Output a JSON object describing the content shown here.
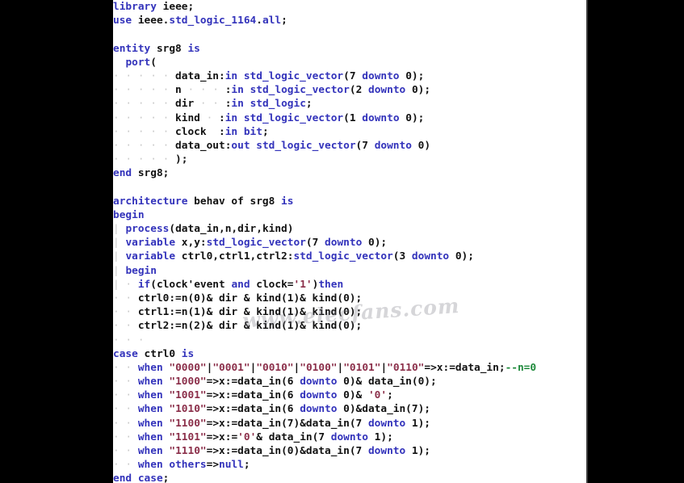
{
  "editor": {
    "background_color": "#ffffff",
    "letterbox_color": "#000000",
    "language": "VHDL",
    "font_style": "monospace-bold",
    "colors": {
      "keyword": "#3333bb",
      "identifier": "#111111",
      "string": "#8b2f4a",
      "comment": "#1f8a3c",
      "indent_guide": "#c9c9c9"
    }
  },
  "watermark": {
    "text": "www.elecfans.com"
  },
  "code": {
    "lines": [
      {
        "n": 1,
        "tokens": [
          {
            "t": "library",
            "c": "kw"
          },
          {
            "t": " ",
            "c": "pun"
          },
          {
            "t": "ieee",
            "c": "id"
          },
          {
            "t": ";",
            "c": "pun"
          }
        ]
      },
      {
        "n": 2,
        "tokens": [
          {
            "t": "use",
            "c": "kw"
          },
          {
            "t": " ",
            "c": "pun"
          },
          {
            "t": "ieee",
            "c": "id"
          },
          {
            "t": ".",
            "c": "pun"
          },
          {
            "t": "std_logic_1164",
            "c": "kw"
          },
          {
            "t": ".",
            "c": "pun"
          },
          {
            "t": "all",
            "c": "kw"
          },
          {
            "t": ";",
            "c": "pun"
          }
        ]
      },
      {
        "n": 3,
        "tokens": []
      },
      {
        "n": 4,
        "tokens": [
          {
            "t": "entity",
            "c": "kw"
          },
          {
            "t": " srg8 ",
            "c": "id"
          },
          {
            "t": "is",
            "c": "kw"
          }
        ]
      },
      {
        "n": 5,
        "tokens": [
          {
            "t": " ",
            "c": "dots"
          },
          {
            "t": " ",
            "c": "pun"
          },
          {
            "t": "port",
            "c": "kw"
          },
          {
            "t": "(",
            "c": "pun"
          }
        ]
      },
      {
        "n": 6,
        "tokens": [
          {
            "t": "· · · · ·",
            "c": "dots"
          },
          {
            "t": " data_in",
            "c": "id"
          },
          {
            "t": ":",
            "c": "pun"
          },
          {
            "t": "in",
            "c": "kw"
          },
          {
            "t": " ",
            "c": "pun"
          },
          {
            "t": "std_logic_vector",
            "c": "kw"
          },
          {
            "t": "(",
            "c": "pun"
          },
          {
            "t": "7",
            "c": "id"
          },
          {
            "t": " ",
            "c": "pun"
          },
          {
            "t": "downto",
            "c": "kw"
          },
          {
            "t": " 0);",
            "c": "id"
          }
        ]
      },
      {
        "n": 7,
        "tokens": [
          {
            "t": "· · · · ·",
            "c": "dots"
          },
          {
            "t": " n",
            "c": "id"
          },
          {
            "t": " · · ·",
            "c": "dots"
          },
          {
            "t": " :",
            "c": "pun"
          },
          {
            "t": "in",
            "c": "kw"
          },
          {
            "t": " ",
            "c": "pun"
          },
          {
            "t": "std_logic_vector",
            "c": "kw"
          },
          {
            "t": "(",
            "c": "pun"
          },
          {
            "t": "2",
            "c": "id"
          },
          {
            "t": " ",
            "c": "pun"
          },
          {
            "t": "downto",
            "c": "kw"
          },
          {
            "t": " 0);",
            "c": "id"
          }
        ]
      },
      {
        "n": 8,
        "tokens": [
          {
            "t": "· · · · ·",
            "c": "dots"
          },
          {
            "t": " dir",
            "c": "id"
          },
          {
            "t": " · ·",
            "c": "dots"
          },
          {
            "t": " :",
            "c": "pun"
          },
          {
            "t": "in",
            "c": "kw"
          },
          {
            "t": " ",
            "c": "pun"
          },
          {
            "t": "std_logic",
            "c": "kw"
          },
          {
            "t": ";",
            "c": "pun"
          }
        ]
      },
      {
        "n": 9,
        "tokens": [
          {
            "t": "· · · · ·",
            "c": "dots"
          },
          {
            "t": " kind",
            "c": "id"
          },
          {
            "t": " ·",
            "c": "dots"
          },
          {
            "t": " :",
            "c": "pun"
          },
          {
            "t": "in",
            "c": "kw"
          },
          {
            "t": " ",
            "c": "pun"
          },
          {
            "t": "std_logic_vector",
            "c": "kw"
          },
          {
            "t": "(",
            "c": "pun"
          },
          {
            "t": "1",
            "c": "id"
          },
          {
            "t": " ",
            "c": "pun"
          },
          {
            "t": "downto",
            "c": "kw"
          },
          {
            "t": " 0);",
            "c": "id"
          }
        ]
      },
      {
        "n": 10,
        "tokens": [
          {
            "t": "· · · · ·",
            "c": "dots"
          },
          {
            "t": " clock",
            "c": "id"
          },
          {
            "t": "  :",
            "c": "pun"
          },
          {
            "t": "in",
            "c": "kw"
          },
          {
            "t": " ",
            "c": "pun"
          },
          {
            "t": "bit",
            "c": "kw"
          },
          {
            "t": ";",
            "c": "pun"
          }
        ]
      },
      {
        "n": 11,
        "tokens": [
          {
            "t": "· · · · ·",
            "c": "dots"
          },
          {
            "t": " data_out",
            "c": "id"
          },
          {
            "t": ":",
            "c": "pun"
          },
          {
            "t": "out",
            "c": "kw"
          },
          {
            "t": " ",
            "c": "pun"
          },
          {
            "t": "std_logic_vector",
            "c": "kw"
          },
          {
            "t": "(",
            "c": "pun"
          },
          {
            "t": "7",
            "c": "id"
          },
          {
            "t": " ",
            "c": "pun"
          },
          {
            "t": "downto",
            "c": "kw"
          },
          {
            "t": " 0)",
            "c": "id"
          }
        ]
      },
      {
        "n": 12,
        "tokens": [
          {
            "t": "· · · · ·",
            "c": "dots"
          },
          {
            "t": " );",
            "c": "pun"
          }
        ]
      },
      {
        "n": 13,
        "tokens": [
          {
            "t": "end",
            "c": "kw"
          },
          {
            "t": " srg8;",
            "c": "id"
          }
        ]
      },
      {
        "n": 14,
        "tokens": []
      },
      {
        "n": 15,
        "tokens": [
          {
            "t": "architecture",
            "c": "kw"
          },
          {
            "t": " behav of srg8 ",
            "c": "id"
          },
          {
            "t": "is",
            "c": "kw"
          }
        ]
      },
      {
        "n": 16,
        "tokens": [
          {
            "t": "begin",
            "c": "kw"
          }
        ]
      },
      {
        "n": 17,
        "tokens": [
          {
            "t": "|",
            "c": "dots"
          },
          {
            "t": " ",
            "c": "pun"
          },
          {
            "t": "process",
            "c": "kw"
          },
          {
            "t": "(data_in,n,dir,kind)",
            "c": "id"
          }
        ]
      },
      {
        "n": 18,
        "tokens": [
          {
            "t": "|",
            "c": "dots"
          },
          {
            "t": " ",
            "c": "pun"
          },
          {
            "t": "variable",
            "c": "kw"
          },
          {
            "t": " x,y:",
            "c": "id"
          },
          {
            "t": "std_logic_vector",
            "c": "kw"
          },
          {
            "t": "(",
            "c": "pun"
          },
          {
            "t": "7",
            "c": "id"
          },
          {
            "t": " ",
            "c": "pun"
          },
          {
            "t": "downto",
            "c": "kw"
          },
          {
            "t": " 0);",
            "c": "id"
          }
        ]
      },
      {
        "n": 19,
        "tokens": [
          {
            "t": "|",
            "c": "dots"
          },
          {
            "t": " ",
            "c": "pun"
          },
          {
            "t": "variable",
            "c": "kw"
          },
          {
            "t": " ctrl0,ctrl1,ctrl2:",
            "c": "id"
          },
          {
            "t": "std_logic_vector",
            "c": "kw"
          },
          {
            "t": "(",
            "c": "pun"
          },
          {
            "t": "3",
            "c": "id"
          },
          {
            "t": " ",
            "c": "pun"
          },
          {
            "t": "downto",
            "c": "kw"
          },
          {
            "t": " 0);",
            "c": "id"
          }
        ]
      },
      {
        "n": 20,
        "tokens": [
          {
            "t": "|",
            "c": "dots"
          },
          {
            "t": " ",
            "c": "pun"
          },
          {
            "t": "begin",
            "c": "kw"
          }
        ]
      },
      {
        "n": 21,
        "tokens": [
          {
            "t": "|",
            "c": "dots"
          },
          {
            "t": " · ",
            "c": "dots"
          },
          {
            "t": "if",
            "c": "kw"
          },
          {
            "t": "(clock'event ",
            "c": "id"
          },
          {
            "t": "and",
            "c": "kw"
          },
          {
            "t": " clock=",
            "c": "id"
          },
          {
            "t": "'1'",
            "c": "str"
          },
          {
            "t": ")",
            "c": "id"
          },
          {
            "t": "then",
            "c": "kw"
          }
        ]
      },
      {
        "n": 22,
        "tokens": [
          {
            "t": "· ·",
            "c": "dots"
          },
          {
            "t": " ctrl0:=n(0)& dir & kind(1)& kind(0);",
            "c": "id"
          }
        ]
      },
      {
        "n": 23,
        "tokens": [
          {
            "t": "· ·",
            "c": "dots"
          },
          {
            "t": " ctrl1:=n(1)& dir & kind(1)& kind(0);",
            "c": "id"
          }
        ]
      },
      {
        "n": 24,
        "tokens": [
          {
            "t": "· ·",
            "c": "dots"
          },
          {
            "t": " ctrl2:=n(2)& dir & kind(1)& kind(0);",
            "c": "id"
          }
        ]
      },
      {
        "n": 25,
        "tokens": [
          {
            "t": "· · ·",
            "c": "dots"
          }
        ]
      },
      {
        "n": 26,
        "tokens": [
          {
            "t": "case",
            "c": "kw"
          },
          {
            "t": " ctrl0 ",
            "c": "id"
          },
          {
            "t": "is",
            "c": "kw"
          }
        ]
      },
      {
        "n": 27,
        "tokens": [
          {
            "t": "· ·",
            "c": "dots"
          },
          {
            "t": " ",
            "c": "pun"
          },
          {
            "t": "when",
            "c": "kw"
          },
          {
            "t": " ",
            "c": "pun"
          },
          {
            "t": "\"0000\"",
            "c": "str"
          },
          {
            "t": "|",
            "c": "id"
          },
          {
            "t": "\"0001\"",
            "c": "str"
          },
          {
            "t": "|",
            "c": "id"
          },
          {
            "t": "\"0010\"",
            "c": "str"
          },
          {
            "t": "|",
            "c": "id"
          },
          {
            "t": "\"0100\"",
            "c": "str"
          },
          {
            "t": "|",
            "c": "id"
          },
          {
            "t": "\"0101\"",
            "c": "str"
          },
          {
            "t": "|",
            "c": "id"
          },
          {
            "t": "\"0110\"",
            "c": "str"
          },
          {
            "t": "=>x:=data_in;",
            "c": "id"
          },
          {
            "t": "--n=0",
            "c": "cmt"
          }
        ]
      },
      {
        "n": 28,
        "tokens": [
          {
            "t": "· ·",
            "c": "dots"
          },
          {
            "t": " ",
            "c": "pun"
          },
          {
            "t": "when",
            "c": "kw"
          },
          {
            "t": " ",
            "c": "pun"
          },
          {
            "t": "\"1000\"",
            "c": "str"
          },
          {
            "t": "=>x:=data_in(6 ",
            "c": "id"
          },
          {
            "t": "downto",
            "c": "kw"
          },
          {
            "t": " 0)& data_in(0);",
            "c": "id"
          }
        ]
      },
      {
        "n": 29,
        "tokens": [
          {
            "t": "· ·",
            "c": "dots"
          },
          {
            "t": " ",
            "c": "pun"
          },
          {
            "t": "when",
            "c": "kw"
          },
          {
            "t": " ",
            "c": "pun"
          },
          {
            "t": "\"1001\"",
            "c": "str"
          },
          {
            "t": "=>x:=data_in(6 ",
            "c": "id"
          },
          {
            "t": "downto",
            "c": "kw"
          },
          {
            "t": " 0)& ",
            "c": "id"
          },
          {
            "t": "'0'",
            "c": "str"
          },
          {
            "t": ";",
            "c": "id"
          }
        ]
      },
      {
        "n": 30,
        "tokens": [
          {
            "t": "· ·",
            "c": "dots"
          },
          {
            "t": " ",
            "c": "pun"
          },
          {
            "t": "when",
            "c": "kw"
          },
          {
            "t": " ",
            "c": "pun"
          },
          {
            "t": "\"1010\"",
            "c": "str"
          },
          {
            "t": "=>x:=data_in(6 ",
            "c": "id"
          },
          {
            "t": "downto",
            "c": "kw"
          },
          {
            "t": " 0)&data_in(7);",
            "c": "id"
          }
        ]
      },
      {
        "n": 31,
        "tokens": [
          {
            "t": "· ·",
            "c": "dots"
          },
          {
            "t": " ",
            "c": "pun"
          },
          {
            "t": "when",
            "c": "kw"
          },
          {
            "t": " ",
            "c": "pun"
          },
          {
            "t": "\"1100\"",
            "c": "str"
          },
          {
            "t": "=>x:=data_in(7)&data_in(7 ",
            "c": "id"
          },
          {
            "t": "downto",
            "c": "kw"
          },
          {
            "t": " 1);",
            "c": "id"
          }
        ]
      },
      {
        "n": 32,
        "tokens": [
          {
            "t": "· ·",
            "c": "dots"
          },
          {
            "t": " ",
            "c": "pun"
          },
          {
            "t": "when",
            "c": "kw"
          },
          {
            "t": " ",
            "c": "pun"
          },
          {
            "t": "\"1101\"",
            "c": "str"
          },
          {
            "t": "=>x:=",
            "c": "id"
          },
          {
            "t": "'0'",
            "c": "str"
          },
          {
            "t": "& data_in(7 ",
            "c": "id"
          },
          {
            "t": "downto",
            "c": "kw"
          },
          {
            "t": " 1);",
            "c": "id"
          }
        ]
      },
      {
        "n": 33,
        "tokens": [
          {
            "t": "· ·",
            "c": "dots"
          },
          {
            "t": " ",
            "c": "pun"
          },
          {
            "t": "when",
            "c": "kw"
          },
          {
            "t": " ",
            "c": "pun"
          },
          {
            "t": "\"1110\"",
            "c": "str"
          },
          {
            "t": "=>x:=data_in(0)&data_in(7 ",
            "c": "id"
          },
          {
            "t": "downto",
            "c": "kw"
          },
          {
            "t": " 1);",
            "c": "id"
          }
        ]
      },
      {
        "n": 34,
        "tokens": [
          {
            "t": "· ·",
            "c": "dots"
          },
          {
            "t": " ",
            "c": "pun"
          },
          {
            "t": "when",
            "c": "kw"
          },
          {
            "t": " ",
            "c": "pun"
          },
          {
            "t": "others",
            "c": "kw"
          },
          {
            "t": "=>",
            "c": "id"
          },
          {
            "t": "null",
            "c": "kw"
          },
          {
            "t": ";",
            "c": "id"
          }
        ]
      },
      {
        "n": 35,
        "tokens": [
          {
            "t": "end",
            "c": "kw"
          },
          {
            "t": " ",
            "c": "pun"
          },
          {
            "t": "case",
            "c": "kw"
          },
          {
            "t": ";",
            "c": "id"
          }
        ]
      }
    ]
  }
}
